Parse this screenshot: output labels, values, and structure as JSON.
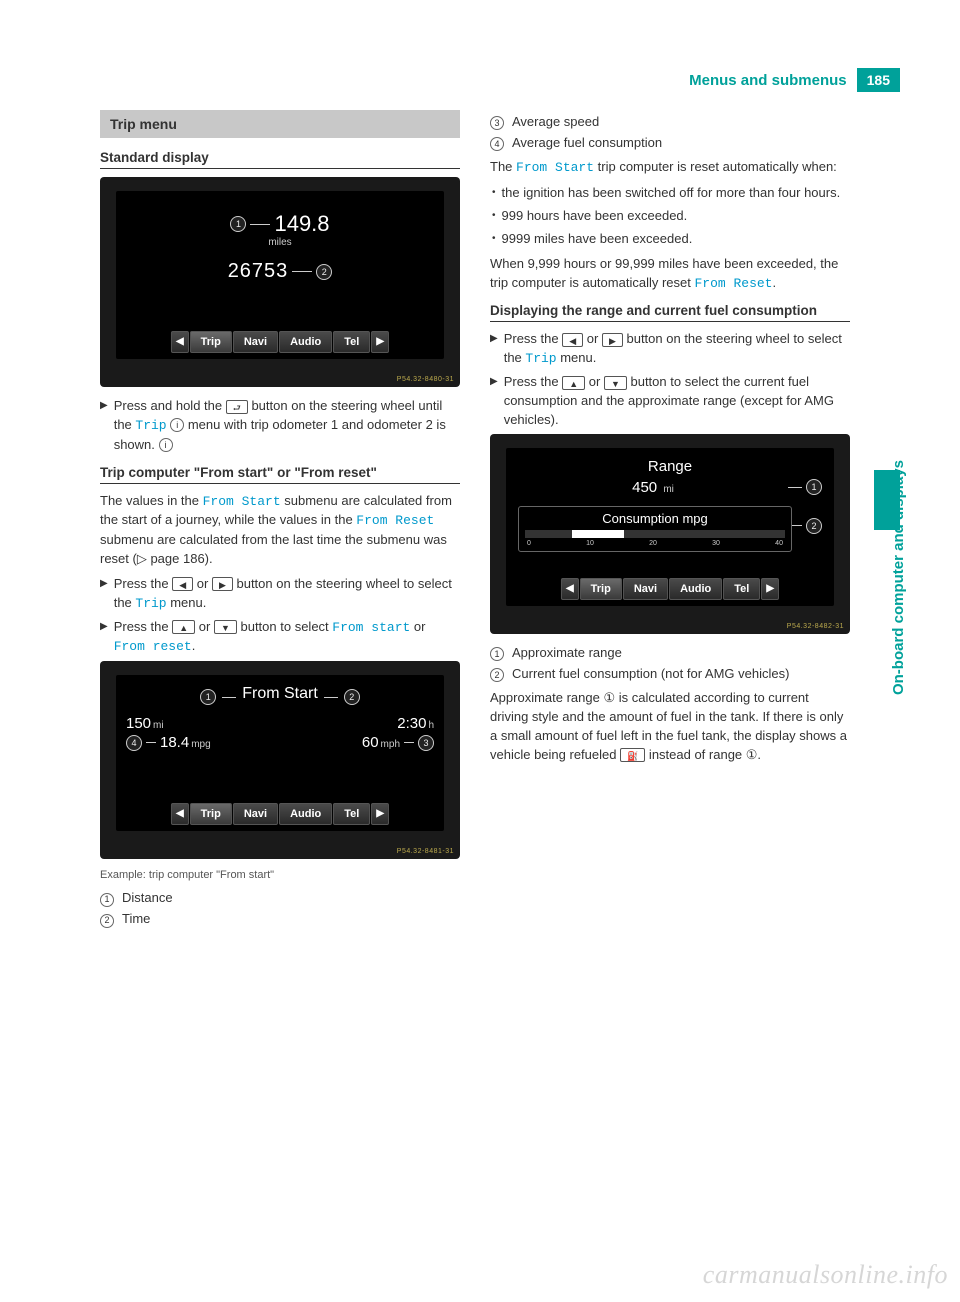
{
  "header": {
    "title": "Menus and submenus",
    "page": "185"
  },
  "sidebar": {
    "label": "On-board computer and displays"
  },
  "left": {
    "section_title": "Trip menu",
    "h1": "Standard display",
    "img1": {
      "trip_val": "149.8",
      "trip_unit": "miles",
      "odo_val": "26753",
      "tabs": [
        "Trip",
        "Navi",
        "Audio",
        "Tel"
      ],
      "tag": "P54.32-8480-31"
    },
    "step1_a": "Press and hold the ",
    "step1_b": " button on the steering wheel until the ",
    "step1_code": "Trip",
    "step1_c": " menu with trip odometer 1 and odometer 2 is shown.",
    "h2": "Trip computer \"From start\" or \"From reset\"",
    "p2a": "The values in the ",
    "p2a_code": "From Start",
    "p2b": " submenu are calculated from the start of a journey, while the values in the ",
    "p2b_code": "From Reset",
    "p2c": " submenu are calculated from the last time the submenu was reset (▷ page 186).",
    "step2_a": "Press the ",
    "step2_b": " or ",
    "step2_c": " button on the steering wheel to select the ",
    "step2_code": "Trip",
    "step2_d": " menu.",
    "step3_a": "Press the ",
    "step3_b": " or ",
    "step3_c": " button to select ",
    "step3_code1": "From start",
    "step3_or": " or ",
    "step3_code2": "From reset",
    "step3_d": ".",
    "img2": {
      "title": "From Start",
      "dist": "150",
      "dist_unit": "mi",
      "time": "2:30",
      "time_unit": "h",
      "mpg": "18.4",
      "mpg_unit": "mpg",
      "mph": "60",
      "mph_unit": "mph",
      "tabs": [
        "Trip",
        "Navi",
        "Audio",
        "Tel"
      ],
      "tag": "P54.32-8481-31"
    },
    "caption2": "Example: trip computer \"From start\"",
    "legend": [
      "Distance",
      "Time"
    ]
  },
  "right": {
    "legend_cont": [
      "Average speed",
      "Average fuel consumption"
    ],
    "p1a": "The ",
    "p1_code": "From Start",
    "p1b": " trip computer is reset automatically when:",
    "bullets": [
      "the ignition has been switched off for more than four hours.",
      "999 hours have been exceeded.",
      "9999 miles have been exceeded."
    ],
    "p2a": "When 9,999 hours or 99,999 miles have been exceeded, the trip computer is automatically reset ",
    "p2_code": "From Reset",
    "p2b": ".",
    "h3": "Displaying the range and current fuel consumption",
    "step4_a": "Press the ",
    "step4_b": " or ",
    "step4_c": " button on the steering wheel to select the ",
    "step4_code": "Trip",
    "step4_d": " menu.",
    "step5_a": "Press the ",
    "step5_b": " or ",
    "step5_c": " button to select the current fuel consumption and the approximate range (except for AMG vehicles).",
    "img3": {
      "range_title": "Range",
      "range_val": "450",
      "range_unit": "mi",
      "cons_title": "Consumption mpg",
      "ticks": [
        "0",
        "10",
        "20",
        "30",
        "40"
      ],
      "tabs": [
        "Trip",
        "Navi",
        "Audio",
        "Tel"
      ],
      "tag": "P54.32-8482-31"
    },
    "legend3": [
      "Approximate range",
      "Current fuel consumption (not for AMG vehicles)"
    ],
    "p3": "Approximate range ① is calculated according to current driving style and the amount of fuel in the tank. If there is only a small amount of fuel left in the fuel tank, the display shows a vehicle being refueled ",
    "p3b": " instead of range ①."
  },
  "watermark": "carmanualsonline.info"
}
